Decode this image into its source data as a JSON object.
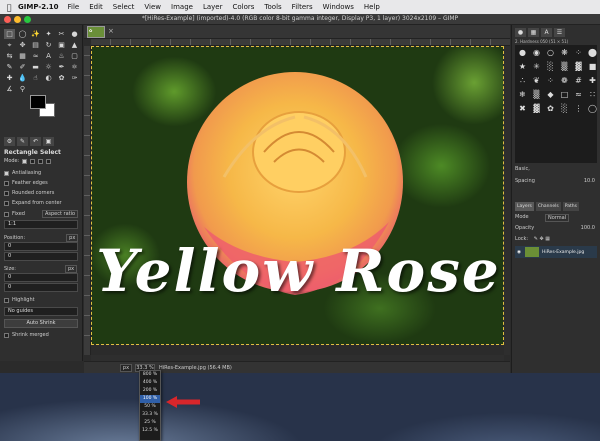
{
  "menubar": {
    "app": "GIMP-2.10",
    "items": [
      "File",
      "Edit",
      "Select",
      "View",
      "Image",
      "Layer",
      "Colors",
      "Tools",
      "Filters",
      "Windows",
      "Help"
    ]
  },
  "window": {
    "title": "*[HiRes-Example] (imported)-4.0 (RGB color 8-bit gamma integer, Display P3, 1 layer) 3024x2109 – GIMP"
  },
  "toolbox": {
    "tool_options_title": "Rectangle Select",
    "mode_label": "Mode:",
    "options": [
      {
        "label": "Antialiasing",
        "checked": true
      },
      {
        "label": "Feather edges",
        "checked": false
      },
      {
        "label": "Rounded corners",
        "checked": false
      },
      {
        "label": "Expand from center",
        "checked": false
      }
    ],
    "fixed_label": "Fixed",
    "fixed_value": "Aspect ratio",
    "ratio_value": "1:1",
    "position_label": "Position:",
    "position_unit": "px",
    "position_x": "0",
    "position_y": "0",
    "size_label": "Size:",
    "size_unit": "px",
    "size_w": "0",
    "size_h": "0",
    "highlight_label": "Highlight",
    "guides_value": "No guides",
    "autoshrink_label": "Auto Shrink",
    "shrink_merged_label": "Shrink merged"
  },
  "canvas": {
    "caption": "Yellow Rose"
  },
  "statusbar": {
    "unit": "px",
    "zoom": "33.3 %",
    "filename": "HiRes-Example.jpg (56.4 MB)"
  },
  "zoom_menu": {
    "items": [
      "800 %",
      "400 %",
      "200 %",
      "100 %",
      "50 %",
      "33.3 %",
      "25 %",
      "12.5 %"
    ],
    "highlighted": "100 %"
  },
  "dock": {
    "brush_header": "2. Hardness 050 (51 × 51)",
    "brush_category": "Basic,",
    "spacing_label": "Spacing",
    "spacing_value": "10.0",
    "layers_tab": "Layers",
    "channels_tab": "Channels",
    "paths_tab": "Paths",
    "mode_label": "Mode",
    "mode_value": "Normal",
    "opacity_label": "Opacity",
    "opacity_value": "100.0",
    "lock_label": "Lock:",
    "layer_name": "HiRes-Example.jpg"
  },
  "colors": {
    "accent_selection": "#2f5fa8",
    "annotation_arrow": "#d8262b"
  }
}
